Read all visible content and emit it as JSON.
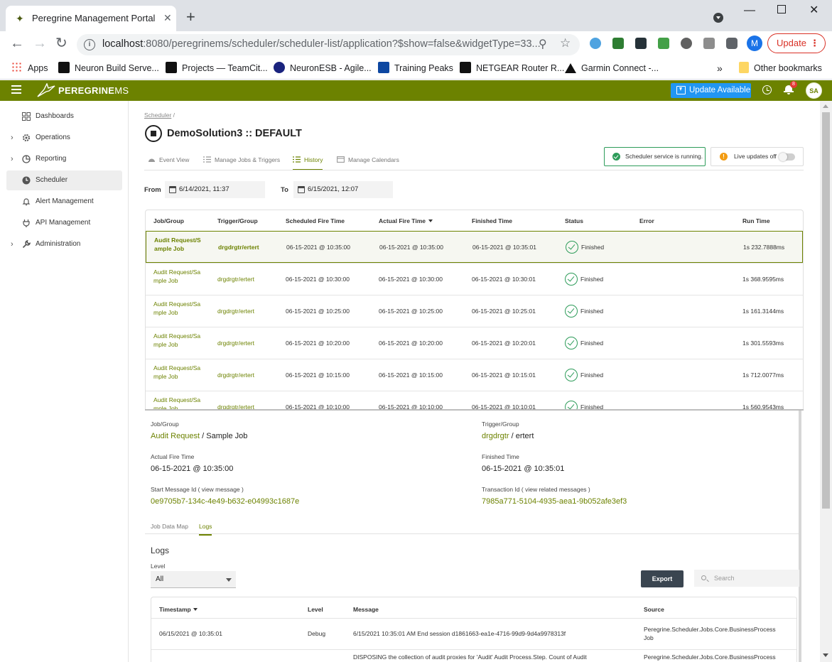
{
  "browser": {
    "tab_title": "Peregrine Management Portal",
    "url_host": "localhost",
    "url_rest": ":8080/peregrinems/scheduler/scheduler-list/application?$show=false&widgetType=33...",
    "profile_initial": "M",
    "update_label": "Update",
    "bookmarks": [
      {
        "label": "Apps",
        "icon": "apps-grid-icon"
      },
      {
        "label": "Neuron Build Serve...",
        "icon": "teamcity-icon"
      },
      {
        "label": "Projects — TeamCit...",
        "icon": "teamcity-icon"
      },
      {
        "label": "NeuronESB - Agile...",
        "icon": "neuron-icon"
      },
      {
        "label": "Training Peaks",
        "icon": "trainingpeaks-icon"
      },
      {
        "label": "NETGEAR Router R...",
        "icon": "netgear-icon"
      },
      {
        "label": "Garmin Connect -...",
        "icon": "garmin-icon"
      }
    ],
    "other_bookmarks": "Other bookmarks",
    "overflow": "»"
  },
  "app": {
    "logo_bold": "PEREGRINE",
    "logo_light": "MS",
    "update_available": "Update Available",
    "notification_count": "8",
    "user_initials": "SA"
  },
  "sidebar": {
    "items": [
      {
        "label": "Dashboards",
        "icon": "dashboard-icon",
        "expandable": false
      },
      {
        "label": "Operations",
        "icon": "gear-icon",
        "expandable": true
      },
      {
        "label": "Reporting",
        "icon": "chart-icon",
        "expandable": true
      },
      {
        "label": "Scheduler",
        "icon": "clock-icon",
        "expandable": false,
        "active": true
      },
      {
        "label": "Alert Management",
        "icon": "bell-icon",
        "expandable": false
      },
      {
        "label": "API Management",
        "icon": "plug-icon",
        "expandable": false
      },
      {
        "label": "Administration",
        "icon": "wrench-icon",
        "expandable": true
      }
    ]
  },
  "page": {
    "breadcrumb": "Scheduler",
    "breadcrumb_sep": "/",
    "title": "DemoSolution3 :: DEFAULT",
    "tabs": [
      {
        "label": "Event View",
        "icon": "gauge-icon"
      },
      {
        "label": "Manage Jobs & Triggers",
        "icon": "list-icon"
      },
      {
        "label": "History",
        "icon": "list-icon",
        "active": true
      },
      {
        "label": "Manage Calendars",
        "icon": "calendar-icon"
      }
    ],
    "service_status": "Scheduler service is running.",
    "live_updates": "Live updates off",
    "from_label": "From",
    "from_value": "6/14/2021, 11:37",
    "to_label": "To",
    "to_value": "6/15/2021, 12:07"
  },
  "history": {
    "columns": [
      "Job/Group",
      "Trigger/Group",
      "Scheduled Fire Time",
      "Actual Fire Time",
      "Finished Time",
      "Status",
      "Error",
      "Run Time"
    ],
    "rows": [
      {
        "job": "Audit Request/Sample Job",
        "trigger": "drgdrgtr/ertert",
        "scheduled": "06-15-2021 @ 10:35:00",
        "actual": "06-15-2021 @ 10:35:00",
        "finished": "06-15-2021 @ 10:35:01",
        "status": "Finished",
        "error": "",
        "runtime": "1s 232.7888ms"
      },
      {
        "job": "Audit Request/Sample Job",
        "trigger": "drgdrgtr/ertert",
        "scheduled": "06-15-2021 @ 10:30:00",
        "actual": "06-15-2021 @ 10:30:00",
        "finished": "06-15-2021 @ 10:30:01",
        "status": "Finished",
        "error": "",
        "runtime": "1s 368.9595ms"
      },
      {
        "job": "Audit Request/Sample Job",
        "trigger": "drgdrgtr/ertert",
        "scheduled": "06-15-2021 @ 10:25:00",
        "actual": "06-15-2021 @ 10:25:00",
        "finished": "06-15-2021 @ 10:25:01",
        "status": "Finished",
        "error": "",
        "runtime": "1s 161.3144ms"
      },
      {
        "job": "Audit Request/Sample Job",
        "trigger": "drgdrgtr/ertert",
        "scheduled": "06-15-2021 @ 10:20:00",
        "actual": "06-15-2021 @ 10:20:00",
        "finished": "06-15-2021 @ 10:20:01",
        "status": "Finished",
        "error": "",
        "runtime": "1s 301.5593ms"
      },
      {
        "job": "Audit Request/Sample Job",
        "trigger": "drgdrgtr/ertert",
        "scheduled": "06-15-2021 @ 10:15:00",
        "actual": "06-15-2021 @ 10:15:00",
        "finished": "06-15-2021 @ 10:15:01",
        "status": "Finished",
        "error": "",
        "runtime": "1s 712.0077ms"
      },
      {
        "job": "Audit Request/Sample Job",
        "trigger": "drgdrgtr/ertert",
        "scheduled": "06-15-2021 @ 10:10:00",
        "actual": "06-15-2021 @ 10:10:00",
        "finished": "06-15-2021 @ 10:10:01",
        "status": "Finished",
        "error": "",
        "runtime": "1s 560.9543ms"
      }
    ]
  },
  "detail": {
    "job_label": "Job/Group",
    "job_name": "Audit Request",
    "job_group": " / Sample Job",
    "trigger_label": "Trigger/Group",
    "trigger_name": "drgdrgtr",
    "trigger_group": " / ertert",
    "actual_label": "Actual Fire Time",
    "actual_value": "06-15-2021 @ 10:35:00",
    "finished_label": "Finished Time",
    "finished_value": "06-15-2021 @ 10:35:01",
    "start_msg_label": "Start Message Id ( view message )",
    "start_msg_value": "0e9705b7-134c-4e49-b632-e04993c1687e",
    "txn_label": "Transaction Id ( view related messages )",
    "txn_value": "7985a771-5104-4935-aea1-9b052afe3ef3",
    "subtabs": [
      "Job Data Map",
      "Logs"
    ],
    "logs_heading": "Logs",
    "level_label": "Level",
    "level_value": "All",
    "export_label": "Export",
    "search_placeholder": "Search",
    "log_columns": [
      "Timestamp",
      "Level",
      "Message",
      "Source"
    ],
    "log_rows": [
      {
        "timestamp": "06/15/2021 @ 10:35:01",
        "level": "Debug",
        "message": "6/15/2021 10:35:01 AM End session d1861663-ea1e-4716-99d9-9d4a9978313f",
        "source_line1": "Peregrine.Scheduler.Jobs.Core.BusinessProcess",
        "source_line2": "Job"
      },
      {
        "timestamp": "",
        "level": "",
        "message": "DISPOSING the collection of audit proxies for 'Audit' Audit Process.Step. Count of Audit",
        "source_line1": "Peregrine.Scheduler.Jobs.Core.BusinessProcess",
        "source_line2": ""
      }
    ]
  },
  "colors": {
    "brand": "#6c8200",
    "accent_blue": "#2196f3",
    "success": "#2e9c5a",
    "warning": "#f39c12"
  }
}
